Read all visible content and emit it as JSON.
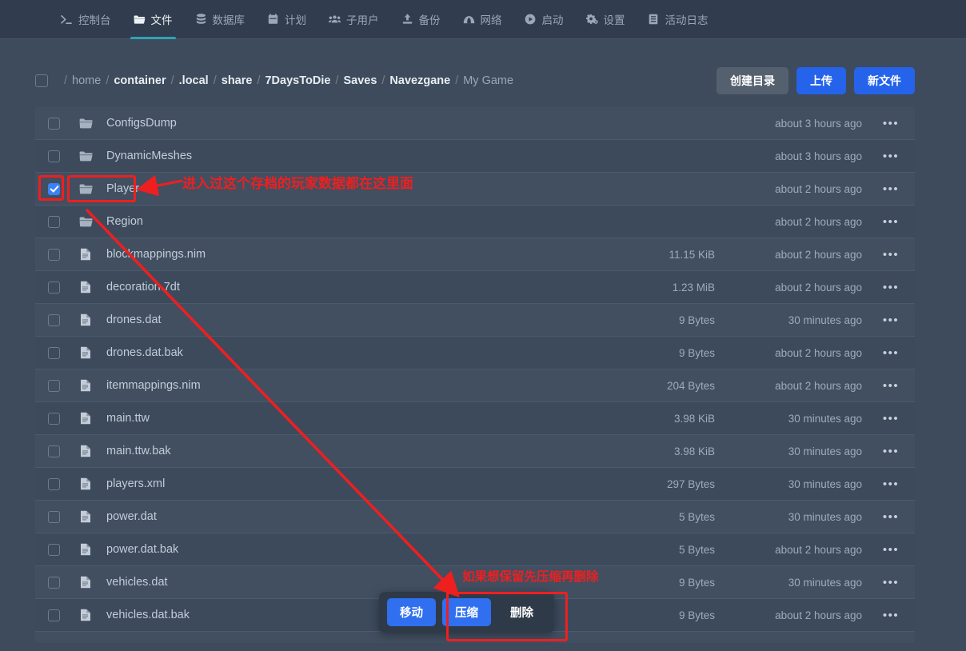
{
  "nav": {
    "tabs": [
      {
        "label": "控制台",
        "icon": "terminal-icon",
        "active": false
      },
      {
        "label": "文件",
        "icon": "folder-icon",
        "active": true
      },
      {
        "label": "数据库",
        "icon": "database-icon",
        "active": false
      },
      {
        "label": "计划",
        "icon": "calendar-icon",
        "active": false
      },
      {
        "label": "子用户",
        "icon": "users-icon",
        "active": false
      },
      {
        "label": "备份",
        "icon": "upload-icon",
        "active": false
      },
      {
        "label": "网络",
        "icon": "network-icon",
        "active": false
      },
      {
        "label": "启动",
        "icon": "play-icon",
        "active": false
      },
      {
        "label": "设置",
        "icon": "gears-icon",
        "active": false
      },
      {
        "label": "活动日志",
        "icon": "log-icon",
        "active": false
      }
    ]
  },
  "breadcrumb": {
    "root": "/",
    "segments": [
      {
        "label": "home",
        "style": "dim"
      },
      {
        "label": "container",
        "style": "bold"
      },
      {
        "label": ".local",
        "style": "bold"
      },
      {
        "label": "share",
        "style": "bold"
      },
      {
        "label": "7DaysToDie",
        "style": "bold"
      },
      {
        "label": "Saves",
        "style": "bold"
      },
      {
        "label": "Navezgane",
        "style": "bold"
      },
      {
        "label": "My Game",
        "style": "last"
      }
    ]
  },
  "toolbar": {
    "create_dir_label": "创建目录",
    "upload_label": "上传",
    "new_file_label": "新文件"
  },
  "files": [
    {
      "name": "ConfigsDump",
      "type": "folder",
      "size": "",
      "time": "about 3 hours ago",
      "checked": false
    },
    {
      "name": "DynamicMeshes",
      "type": "folder",
      "size": "",
      "time": "about 3 hours ago",
      "checked": false
    },
    {
      "name": "Player",
      "type": "folder",
      "size": "",
      "time": "about 2 hours ago",
      "checked": true
    },
    {
      "name": "Region",
      "type": "folder",
      "size": "",
      "time": "about 2 hours ago",
      "checked": false
    },
    {
      "name": "blockmappings.nim",
      "type": "file",
      "size": "11.15 KiB",
      "time": "about 2 hours ago",
      "checked": false
    },
    {
      "name": "decoration.7dt",
      "type": "file",
      "size": "1.23 MiB",
      "time": "about 2 hours ago",
      "checked": false
    },
    {
      "name": "drones.dat",
      "type": "file",
      "size": "9 Bytes",
      "time": "30 minutes ago",
      "checked": false
    },
    {
      "name": "drones.dat.bak",
      "type": "file",
      "size": "9 Bytes",
      "time": "about 2 hours ago",
      "checked": false
    },
    {
      "name": "itemmappings.nim",
      "type": "file",
      "size": "204 Bytes",
      "time": "about 2 hours ago",
      "checked": false
    },
    {
      "name": "main.ttw",
      "type": "file",
      "size": "3.98 KiB",
      "time": "30 minutes ago",
      "checked": false
    },
    {
      "name": "main.ttw.bak",
      "type": "file",
      "size": "3.98 KiB",
      "time": "30 minutes ago",
      "checked": false
    },
    {
      "name": "players.xml",
      "type": "file",
      "size": "297 Bytes",
      "time": "30 minutes ago",
      "checked": false
    },
    {
      "name": "power.dat",
      "type": "file",
      "size": "5 Bytes",
      "time": "30 minutes ago",
      "checked": false
    },
    {
      "name": "power.dat.bak",
      "type": "file",
      "size": "5 Bytes",
      "time": "about 2 hours ago",
      "checked": false
    },
    {
      "name": "vehicles.dat",
      "type": "file",
      "size": "9 Bytes",
      "time": "30 minutes ago",
      "checked": false
    },
    {
      "name": "vehicles.dat.bak",
      "type": "file",
      "size": "9 Bytes",
      "time": "about 2 hours ago",
      "checked": false
    }
  ],
  "actions": {
    "move_label": "移动",
    "archive_label": "压缩",
    "delete_label": "删除"
  },
  "annotations": [
    {
      "id": "player-note",
      "text": "进入过这个存档的玩家数据都在这里面"
    },
    {
      "id": "archive-note",
      "text": "如果想保留先压缩再删除"
    }
  ],
  "colors": {
    "accent_blue": "#2563eb",
    "tab_underline": "#2ea3b5",
    "annotation_red": "#ef1f1f",
    "page_bg": "#3d4b5c",
    "row_bg": "#414f61"
  }
}
